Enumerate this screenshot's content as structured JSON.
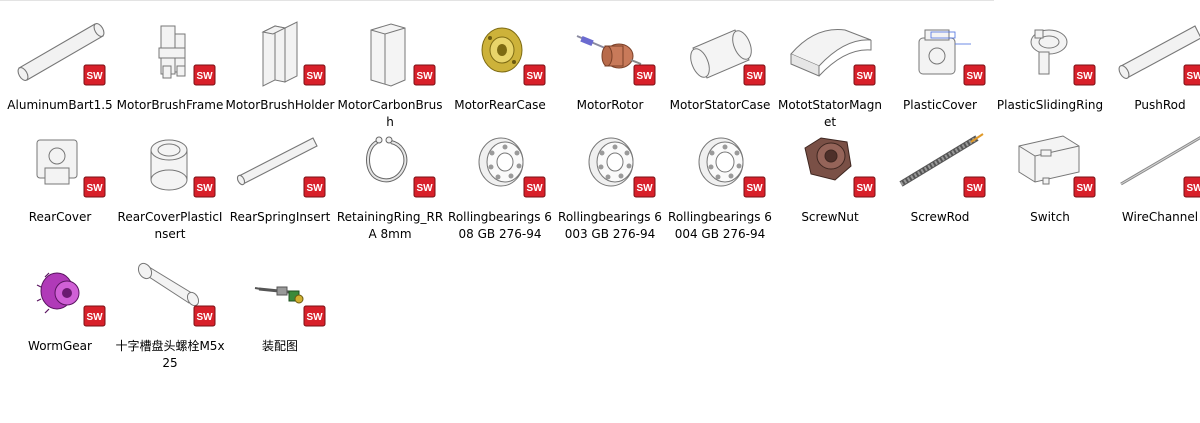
{
  "files": [
    {
      "name": "AluminumBart1.5",
      "icon": "aluminum-tube-icon"
    },
    {
      "name": "MotorBrushFrame",
      "icon": "brush-frame-icon"
    },
    {
      "name": "MotorBrushHolder",
      "icon": "brush-holder-icon"
    },
    {
      "name": "MotorCarbonBrush",
      "icon": "carbon-brush-icon"
    },
    {
      "name": "MotorRearCase",
      "icon": "rear-case-icon"
    },
    {
      "name": "MotorRotor",
      "icon": "rotor-icon"
    },
    {
      "name": "MotorStatorCase",
      "icon": "stator-case-icon"
    },
    {
      "name": "MototStatorMagnet",
      "icon": "stator-magnet-icon"
    },
    {
      "name": "PlasticCover",
      "icon": "plastic-cover-icon"
    },
    {
      "name": "PlasticSlidingRing",
      "icon": "sliding-ring-icon"
    },
    {
      "name": "PushRod",
      "icon": "push-rod-icon"
    },
    {
      "name": "RearCover",
      "icon": "rear-cover-icon"
    },
    {
      "name": "RearCoverPlasticInsert",
      "icon": "plastic-insert-icon"
    },
    {
      "name": "RearSpringInsert",
      "icon": "spring-insert-icon"
    },
    {
      "name": "RetainingRing_RRA 8mm",
      "icon": "retaining-ring-icon"
    },
    {
      "name": "Rollingbearings 608 GB 276-94",
      "icon": "bearing-icon"
    },
    {
      "name": "Rollingbearings 6003 GB 276-94",
      "icon": "bearing-icon"
    },
    {
      "name": "Rollingbearings 6004 GB 276-94",
      "icon": "bearing-icon"
    },
    {
      "name": "ScrewNut",
      "icon": "screw-nut-icon"
    },
    {
      "name": "ScrewRod",
      "icon": "screw-rod-icon"
    },
    {
      "name": "Switch",
      "icon": "switch-icon"
    },
    {
      "name": "WireChannel",
      "icon": "wire-channel-icon"
    },
    {
      "name": "WormGear",
      "icon": "worm-gear-icon"
    },
    {
      "name": "十字槽盘头螺栓M5x25",
      "icon": "bolt-icon"
    },
    {
      "name": "装配图",
      "icon": "assembly-icon"
    }
  ],
  "badge": {
    "text": "SW",
    "color": "#d8202a"
  }
}
